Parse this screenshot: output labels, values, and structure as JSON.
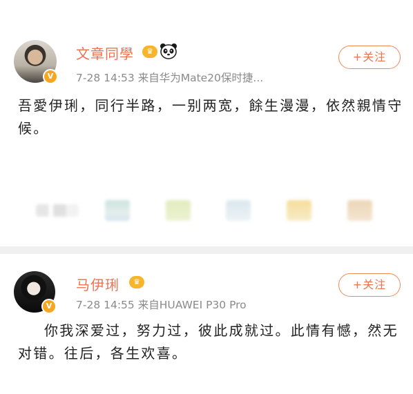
{
  "posts": [
    {
      "author": "文章同學",
      "badge_icon": "vip-crown-icon",
      "extra_icon": "panda-icon",
      "verified_icon": "verified-v-icon",
      "meta": "7-28 14:53  来自华为Mate20保时捷...",
      "follow_label": "+关注",
      "text": "吾愛伊琍，同行半路，一别两宽，餘生漫漫，依然親情守候。"
    },
    {
      "author": "马伊琍",
      "badge_icon": "vip-crown-icon",
      "verified_icon": "verified-v-icon",
      "meta": "7-28 14:55  来自HUAWEI P30 Pro",
      "follow_label": "+关注",
      "text": "你我深爱过，努力过，彼此成就过。此情有憾，然无对错。往后，各生欢喜。"
    }
  ],
  "action_bar": {
    "items": [
      "share-icon",
      "comment-icon",
      "like-icon",
      "gift-icon",
      "star-icon",
      "more-icon"
    ]
  },
  "colors": {
    "accent": "#eb7350",
    "meta_text": "#8a8a8a",
    "body_text": "#222222",
    "divider": "#f0f0f0"
  }
}
